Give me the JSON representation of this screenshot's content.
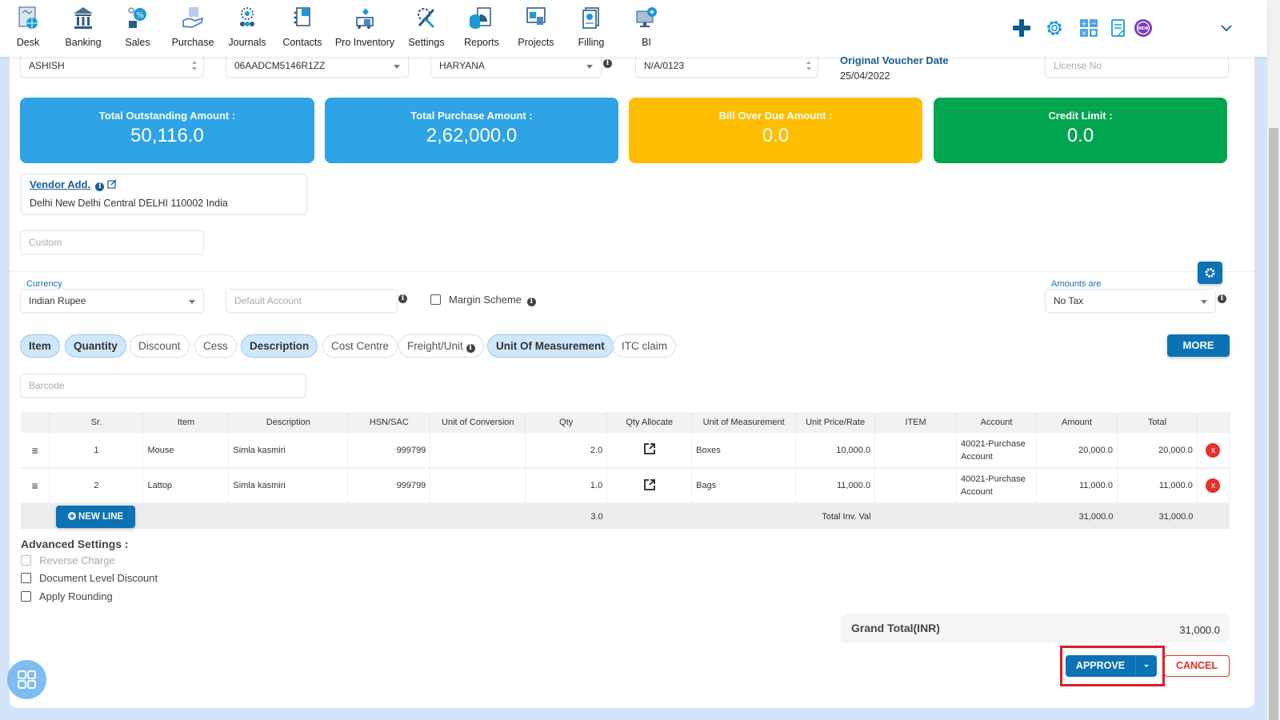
{
  "nav": {
    "items": [
      {
        "label": "Desk",
        "icon": "desk-icon"
      },
      {
        "label": "Banking",
        "icon": "bank-icon"
      },
      {
        "label": "Sales",
        "icon": "sales-icon"
      },
      {
        "label": "Purchase",
        "icon": "purchase-icon"
      },
      {
        "label": "Journals",
        "icon": "journals-icon"
      },
      {
        "label": "Contacts",
        "icon": "contacts-icon"
      },
      {
        "label": "Pro Inventory",
        "icon": "inventory-icon"
      },
      {
        "label": "Settings",
        "icon": "settings-icon"
      },
      {
        "label": "Reports",
        "icon": "reports-icon"
      },
      {
        "label": "Projects",
        "icon": "projects-icon"
      },
      {
        "label": "Filling",
        "icon": "filing-icon"
      },
      {
        "label": "BI",
        "icon": "bi-icon"
      }
    ],
    "right_icons": [
      "plus-icon",
      "gear-icon",
      "calculator-icon",
      "notes-icon",
      "new-badge-icon",
      "chevron-down-icon"
    ]
  },
  "header_fields": {
    "vendor": "ASHISH",
    "gstin": "06AADCM5146R1ZZ",
    "state": "HARYANA",
    "voucher_no": "N/A/0123",
    "original_voucher_date_label": "Original Voucher Date",
    "original_voucher_date": "25/04/2022",
    "license_placeholder": "License No"
  },
  "cards": [
    {
      "title": "Total Outstanding Amount :",
      "value": "50,116.0",
      "color": "#2ea3e6"
    },
    {
      "title": "Total Purchase Amount :",
      "value": "2,62,000.0",
      "color": "#2ea3e6"
    },
    {
      "title": "Bill Over Due Amount :",
      "value": "0.0",
      "color": "#fdbd00"
    },
    {
      "title": "Credit Limit :",
      "value": "0.0",
      "color": "#00a54f"
    }
  ],
  "vendor_address": {
    "label": "Vendor Add.",
    "address": "Delhi New Delhi Central DELHI 110002 India"
  },
  "custom_placeholder": "Custom",
  "currency": {
    "label": "Currency",
    "value": "Indian Rupee"
  },
  "default_account_placeholder": "Default Account",
  "margin_scheme_label": "Margin Scheme",
  "amounts_are": {
    "label": "Amounts are",
    "value": "No Tax"
  },
  "chips": [
    {
      "label": "Item",
      "active": true
    },
    {
      "label": "Quantity",
      "active": true
    },
    {
      "label": "Discount",
      "active": false
    },
    {
      "label": "Cess",
      "active": false
    },
    {
      "label": "Description",
      "active": true
    },
    {
      "label": "Cost Centre",
      "active": false
    },
    {
      "label": "Freight/Unit",
      "active": false
    },
    {
      "label": "Unit Of Measurement",
      "active": true
    },
    {
      "label": "ITC claim",
      "active": false
    }
  ],
  "more_label": "MORE",
  "barcode_placeholder": "Barcode",
  "table": {
    "columns": [
      "",
      "Sr.",
      "Item",
      "Description",
      "HSN/SAC",
      "Unit of Conversion",
      "Qty",
      "Qty Allocate",
      "Unit of Measurement",
      "Unit Price/Rate",
      "ITEM",
      "Account",
      "Amount",
      "Total",
      ""
    ],
    "rows": [
      {
        "sr": "1",
        "item": "Mouse",
        "description": "Simla kasmiri",
        "hsn": "999799",
        "conversion": "",
        "qty": "2.0",
        "uom": "Boxes",
        "rate": "10,000.0",
        "item2": "",
        "account": "40021-Purchase Account",
        "amount": "20,000.0",
        "total": "20,000.0"
      },
      {
        "sr": "2",
        "item": "Lattop",
        "description": "Simla kasmiri",
        "hsn": "999799",
        "conversion": "",
        "qty": "1.0",
        "uom": "Bags",
        "rate": "11,000.0",
        "item2": "",
        "account": "40021-Purchase Account",
        "amount": "11,000.0",
        "total": "11,000.0"
      }
    ],
    "footer": {
      "new_line_label": "NEW LINE",
      "qty_total": "3.0",
      "total_label": "Total Inv. Val",
      "amount_total": "31,000.0",
      "grand_total": "31,000.0"
    }
  },
  "advanced": {
    "title": "Advanced Settings :",
    "options": [
      {
        "label": "Reverse Charge",
        "checked": false,
        "disabled": true
      },
      {
        "label": "Document Level Discount",
        "checked": false,
        "disabled": false
      },
      {
        "label": "Apply Rounding",
        "checked": false,
        "disabled": false
      }
    ]
  },
  "grand_total": {
    "label": "Grand Total(INR)",
    "value": "31,000.0"
  },
  "actions": {
    "approve": "APPROVE",
    "cancel": "CANCEL"
  }
}
